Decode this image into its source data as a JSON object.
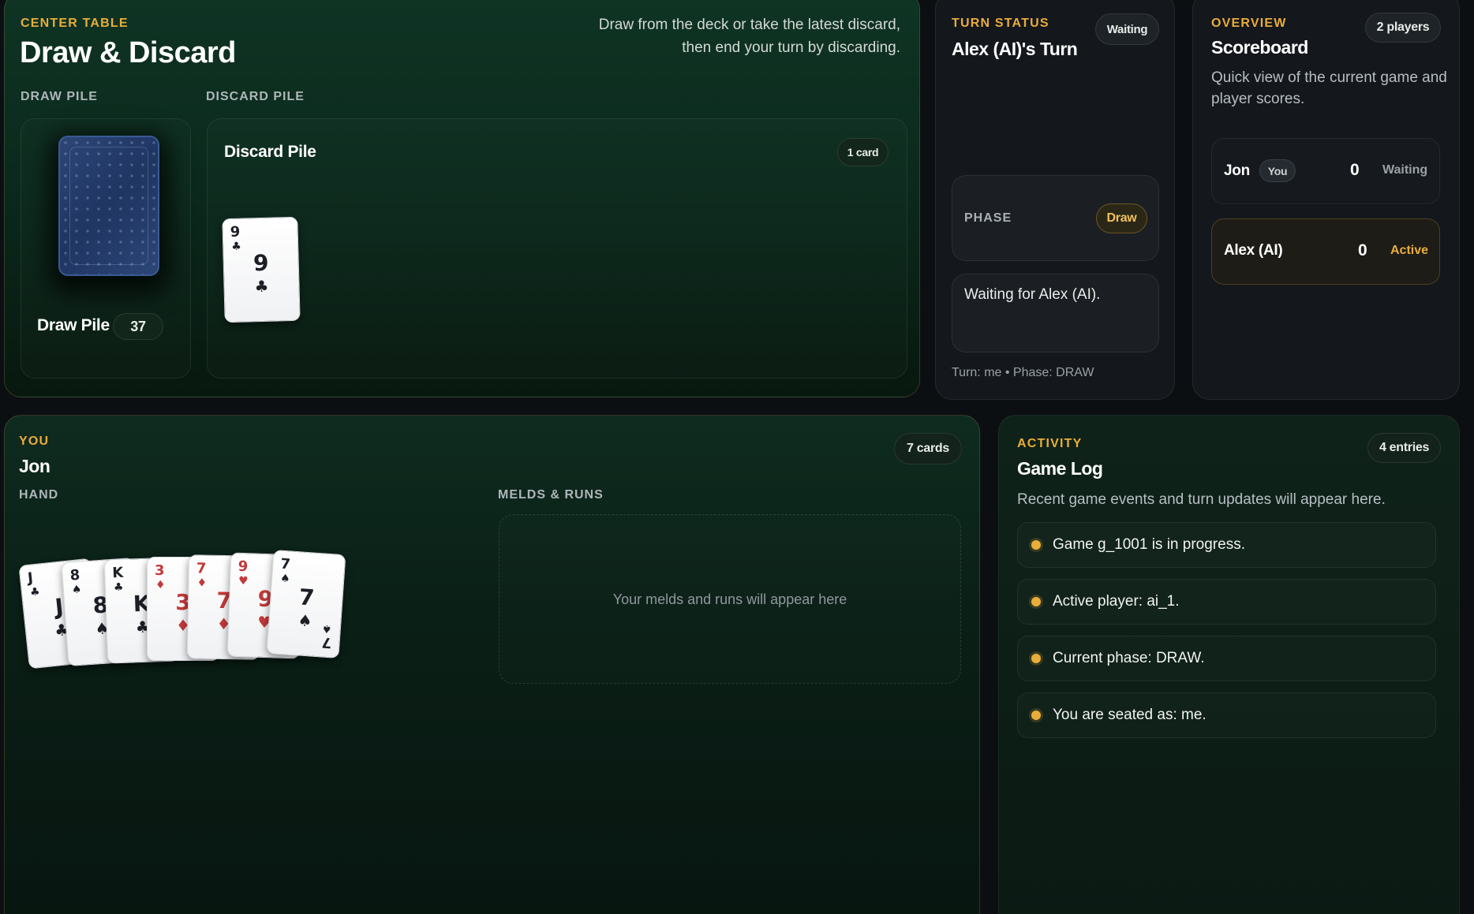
{
  "center_table": {
    "eyebrow": "CENTER TABLE",
    "title": "Draw & Discard",
    "instructions_line1": "Draw from the deck or take the latest discard,",
    "instructions_line2": "then end your turn by discarding.",
    "draw_pile_label": "DRAW PILE",
    "discard_pile_label": "DISCARD PILE",
    "draw_pile": {
      "name": "Draw Pile",
      "count": "37"
    },
    "discard_pile": {
      "name": "Discard Pile",
      "count_badge": "1 card",
      "top_card": {
        "rank": "9",
        "suit": "♣",
        "color": "black"
      }
    }
  },
  "turn_status": {
    "eyebrow": "TURN STATUS",
    "title": "Alex (AI)'s Turn",
    "badge": "Waiting",
    "phase_label": "PHASE",
    "phase_value": "Draw",
    "message": "Waiting for Alex (AI).",
    "footer": "Turn: me • Phase: DRAW"
  },
  "overview": {
    "eyebrow": "OVERVIEW",
    "title": "Scoreboard",
    "badge": "2 players",
    "description_line1": "Quick view of the current game and",
    "description_line2": "player scores.",
    "players": [
      {
        "name": "Jon",
        "tag": "You",
        "score": "0",
        "status": "Waiting"
      },
      {
        "name": "Alex (AI)",
        "tag": "",
        "score": "0",
        "status": "Active"
      }
    ]
  },
  "you": {
    "eyebrow": "YOU",
    "name": "Jon",
    "badge": "7 cards",
    "hand_label": "HAND",
    "melds_label": "MELDS & RUNS",
    "melds_empty": "Your melds and runs will appear here",
    "hand": [
      {
        "rank": "J",
        "suit": "♣",
        "color": "black"
      },
      {
        "rank": "8",
        "suit": "♠",
        "color": "black"
      },
      {
        "rank": "K",
        "suit": "♣",
        "color": "black"
      },
      {
        "rank": "3",
        "suit": "♦",
        "color": "red"
      },
      {
        "rank": "7",
        "suit": "♦",
        "color": "red"
      },
      {
        "rank": "9",
        "suit": "♥",
        "color": "red"
      },
      {
        "rank": "7",
        "suit": "♠",
        "color": "black"
      }
    ]
  },
  "activity": {
    "eyebrow": "ACTIVITY",
    "title": "Game Log",
    "badge": "4 entries",
    "description": "Recent game events and turn updates will appear here.",
    "entries": [
      "Game g_1001 is in progress.",
      "Active player: ai_1.",
      "Current phase: DRAW.",
      "You are seated as: me."
    ]
  },
  "colors": {
    "accent": "#e9ad3a",
    "felt": "#0b2a1d",
    "panel": "#14171c",
    "red_suit": "#c23a3a",
    "black_suit": "#1c1f26"
  }
}
